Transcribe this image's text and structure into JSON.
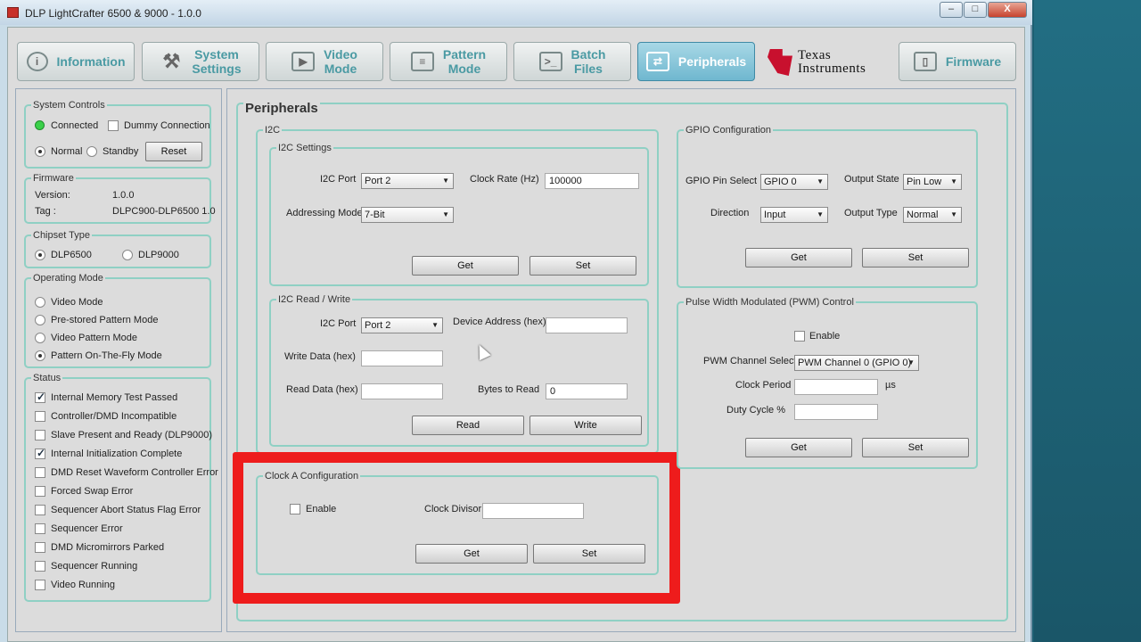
{
  "window": {
    "title": "DLP LightCrafter 6500 & 9000 - 1.0.0",
    "controls": [
      "–",
      "□",
      "X"
    ]
  },
  "tabs": [
    {
      "label": "Information",
      "icon": "info-icon",
      "glyph": "i"
    },
    {
      "label": "System\nSettings",
      "icon": "wrench-icon",
      "glyph": "⚒"
    },
    {
      "label": "Video\nMode",
      "icon": "play-icon",
      "glyph": "▶"
    },
    {
      "label": "Pattern\nMode",
      "icon": "pattern-icon",
      "glyph": "≡"
    },
    {
      "label": "Batch\nFiles",
      "icon": "terminal-icon",
      "glyph": ">_"
    },
    {
      "label": "Peripherals",
      "icon": "arrows-icon",
      "glyph": "⇄"
    },
    {
      "label": "Firmware",
      "icon": "chip-icon",
      "glyph": "▯"
    }
  ],
  "logo": {
    "line1": "Texas",
    "line2": "Instruments"
  },
  "sidebar": {
    "system_controls": {
      "title": "System Controls",
      "connected": "Connected",
      "dummy": "Dummy Connection",
      "normal": "Normal",
      "standby": "Standby",
      "reset": "Reset"
    },
    "firmware": {
      "title": "Firmware",
      "version_label": "Version:",
      "version": "1.0.0",
      "tag_label": "Tag :",
      "tag": "DLPC900-DLP6500 1.0"
    },
    "chipset": {
      "title": "Chipset Type",
      "opt1": "DLP6500",
      "opt2": "DLP9000"
    },
    "operating_mode": {
      "title": "Operating Mode",
      "options": [
        "Video  Mode",
        "Pre-stored Pattern Mode",
        "Video Pattern Mode",
        "Pattern On-The-Fly Mode"
      ]
    },
    "status": {
      "title": "Status",
      "items": [
        {
          "label": "Internal Memory Test Passed",
          "checked": true
        },
        {
          "label": "Controller/DMD Incompatible",
          "checked": false
        },
        {
          "label": "Slave Present and Ready (DLP9000)",
          "checked": false
        },
        {
          "label": "Internal Initialization Complete",
          "checked": true
        },
        {
          "label": "DMD Reset Waveform Controller Error",
          "checked": false
        },
        {
          "label": "Forced Swap Error",
          "checked": false
        },
        {
          "label": "Sequencer Abort Status Flag Error",
          "checked": false
        },
        {
          "label": "Sequencer Error",
          "checked": false
        },
        {
          "label": "DMD Micromirrors Parked",
          "checked": false
        },
        {
          "label": "Sequencer Running",
          "checked": false
        },
        {
          "label": "Video Running",
          "checked": false
        }
      ]
    }
  },
  "peripherals": {
    "title": "Peripherals",
    "i2c": {
      "title": "I2C",
      "settings": {
        "title": "I2C Settings",
        "port_label": "I2C Port",
        "port": "Port 2",
        "clock_label": "Clock Rate (Hz)",
        "clock": "100000",
        "addr_label": "Addressing Mode",
        "addr": "7-Bit",
        "get": "Get",
        "set": "Set"
      },
      "rw": {
        "title": "I2C Read / Write",
        "port_label": "I2C Port",
        "port": "Port 2",
        "dev_label": "Device Address (hex)",
        "dev": "",
        "write_label": "Write Data (hex)",
        "write": "",
        "read_label": "Read Data (hex)",
        "read": "",
        "bytes_label": "Bytes to Read",
        "bytes": "0",
        "read_btn": "Read",
        "write_btn": "Write"
      }
    },
    "clock_a": {
      "title": "Clock A Configuration",
      "enable": "Enable",
      "divisor_label": "Clock Divisor",
      "divisor": "",
      "get": "Get",
      "set": "Set"
    },
    "gpio": {
      "title": "GPIO Configuration",
      "pin_label": "GPIO Pin Select",
      "pin": "GPIO 0",
      "state_label": "Output State",
      "state": "Pin Low",
      "dir_label": "Direction",
      "dir": "Input",
      "type_label": "Output Type",
      "type": "Normal",
      "get": "Get",
      "set": "Set"
    },
    "pwm": {
      "title": "Pulse Width Modulated (PWM) Control",
      "enable": "Enable",
      "channel_label": "PWM Channel Select",
      "channel": "PWM Channel 0 (GPIO 0)",
      "period_label": "Clock Period",
      "period_unit": "µs",
      "period": "",
      "duty_label": "Duty Cycle %",
      "duty": "",
      "get": "Get",
      "set": "Set"
    }
  },
  "colors": {
    "highlight": "#ee1c1c",
    "tab_active": "#6fb7cf",
    "group_border": "#8fd0c4"
  }
}
